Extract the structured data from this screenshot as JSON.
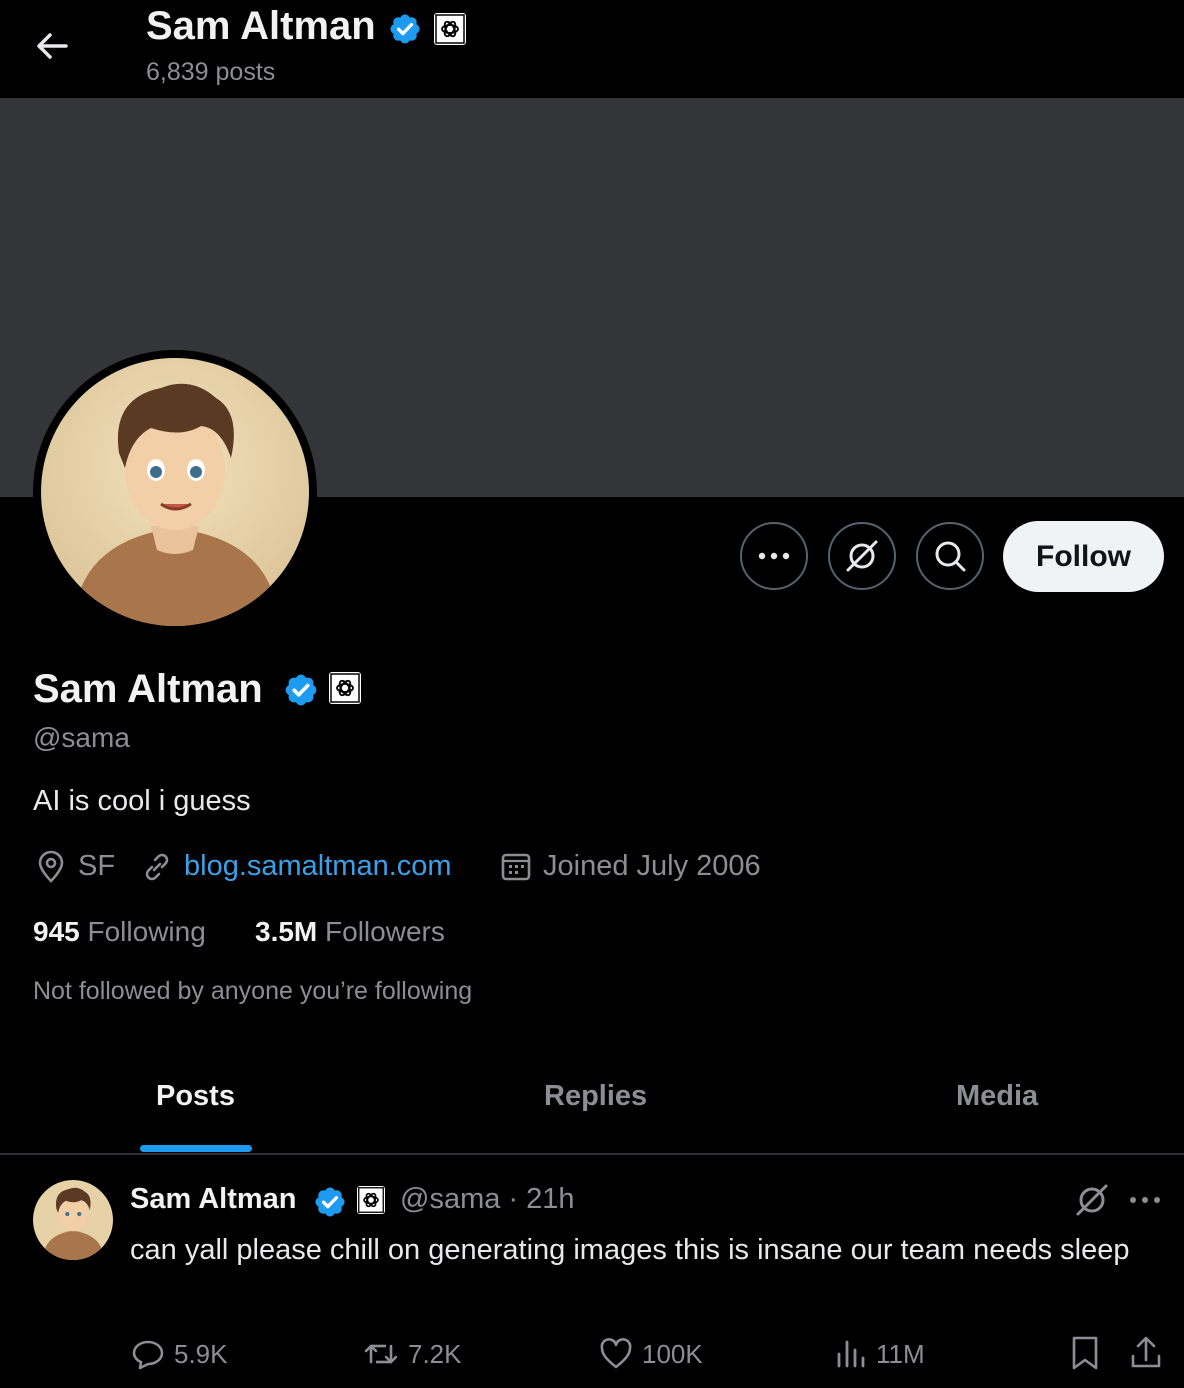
{
  "header": {
    "name": "Sam Altman",
    "posts_count": "6,839 posts"
  },
  "profile": {
    "name": "Sam Altman",
    "handle": "@sama",
    "bio": "AI is cool i guess",
    "location": "SF",
    "website": "blog.samaltman.com",
    "joined": "Joined July 2006",
    "following_count": "945",
    "following_label": "Following",
    "followers_count": "3.5M",
    "followers_label": "Followers",
    "followed_by_note": "Not followed by anyone you’re following"
  },
  "actions": {
    "follow_label": "Follow"
  },
  "tabs": [
    {
      "label": "Posts",
      "active": true
    },
    {
      "label": "Replies",
      "active": false
    },
    {
      "label": "Media",
      "active": false
    }
  ],
  "tweet": {
    "author_name": "Sam Altman",
    "author_handle_time": "@sama · 21h",
    "text": "can yall please chill on generating images this is insane our team needs sleep",
    "replies": "5.9K",
    "reposts": "7.2K",
    "likes": "100K",
    "views": "11M"
  },
  "colors": {
    "background": "#000000",
    "banner": "#333539",
    "accent": "#1d9bf0",
    "link": "#3aa0e8",
    "muted_text": "#8b8f94",
    "verified": "#1d9bf0"
  },
  "icons": [
    "back-arrow-icon",
    "verified-badge-icon",
    "openai-logo-icon",
    "more-icon",
    "grok-icon",
    "search-icon",
    "location-icon",
    "link-icon",
    "calendar-icon",
    "reply-icon",
    "repost-icon",
    "like-icon",
    "views-icon",
    "bookmark-icon",
    "share-icon"
  ]
}
